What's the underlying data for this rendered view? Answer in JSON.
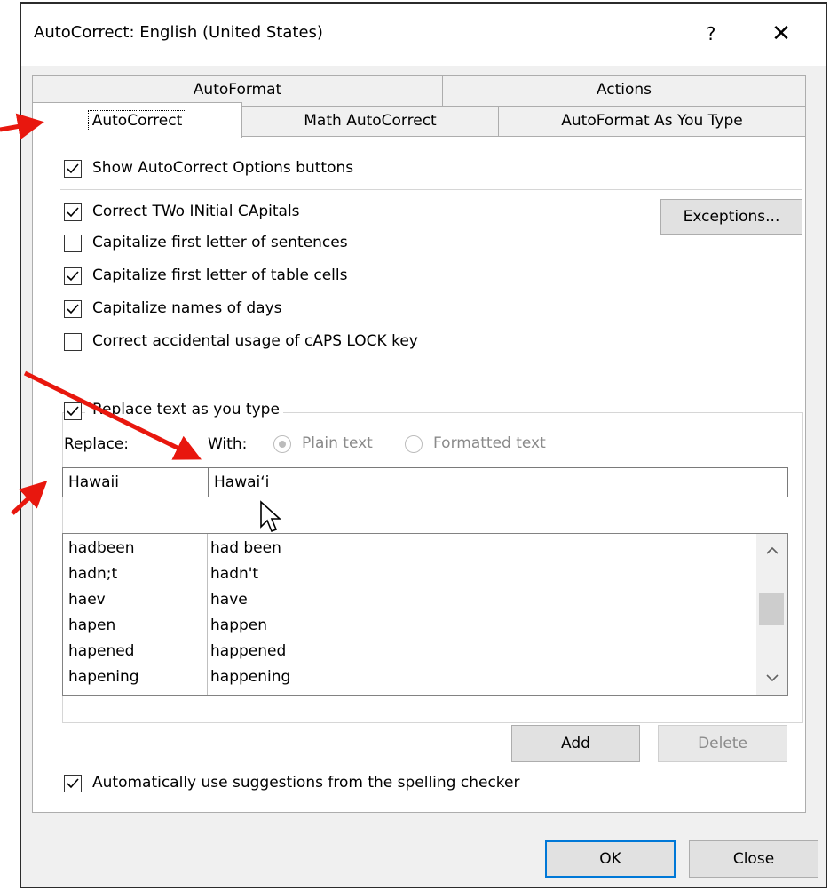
{
  "window": {
    "title": "AutoCorrect: English (United States)",
    "help_label": "?",
    "close_label": "✕"
  },
  "tabs": {
    "row1": [
      "AutoFormat",
      "Actions"
    ],
    "row2": [
      "AutoCorrect",
      "Math AutoCorrect",
      "AutoFormat As You Type"
    ],
    "active": "AutoCorrect"
  },
  "options": {
    "show_buttons": {
      "label": "Show AutoCorrect Options buttons",
      "checked": true
    },
    "correct_two_initial": {
      "label": "Correct TWo INitial CApitals",
      "checked": true
    },
    "capitalize_sentences": {
      "label": "Capitalize first letter of sentences",
      "checked": false
    },
    "capitalize_table_cells": {
      "label": "Capitalize first letter of table cells",
      "checked": true
    },
    "capitalize_days": {
      "label": "Capitalize names of days",
      "checked": true
    },
    "caps_lock": {
      "label": "Correct accidental usage of cAPS LOCK key",
      "checked": false
    },
    "exceptions_button": "Exceptions..."
  },
  "replace_group": {
    "replace_as_you_type": {
      "label": "Replace text as you type",
      "checked": true
    },
    "replace_label": "Replace:",
    "with_label": "With:",
    "plain_text_label": "Plain text",
    "formatted_text_label": "Formatted text",
    "plain_text_selected": true,
    "replace_value": "Hawaii",
    "with_value": "Hawai‘i"
  },
  "entries": [
    {
      "replace": "hadbeen",
      "with": "had been"
    },
    {
      "replace": "hadn;t",
      "with": "hadn't"
    },
    {
      "replace": "haev",
      "with": "have"
    },
    {
      "replace": "hapen",
      "with": "happen"
    },
    {
      "replace": "hapened",
      "with": "happened"
    },
    {
      "replace": "hapening",
      "with": "happening"
    }
  ],
  "list_scroll": {
    "up": "^",
    "down": "v"
  },
  "buttons": {
    "add": "Add",
    "delete": "Delete",
    "ok": "OK",
    "close": "Close"
  },
  "spelling_suggestions": {
    "label": "Automatically use suggestions from the spelling checker",
    "checked": true
  },
  "colors": {
    "annotation_arrow": "#e8170e",
    "dialog_bg": "#f0f0f0",
    "focus_border": "#0078d7"
  }
}
